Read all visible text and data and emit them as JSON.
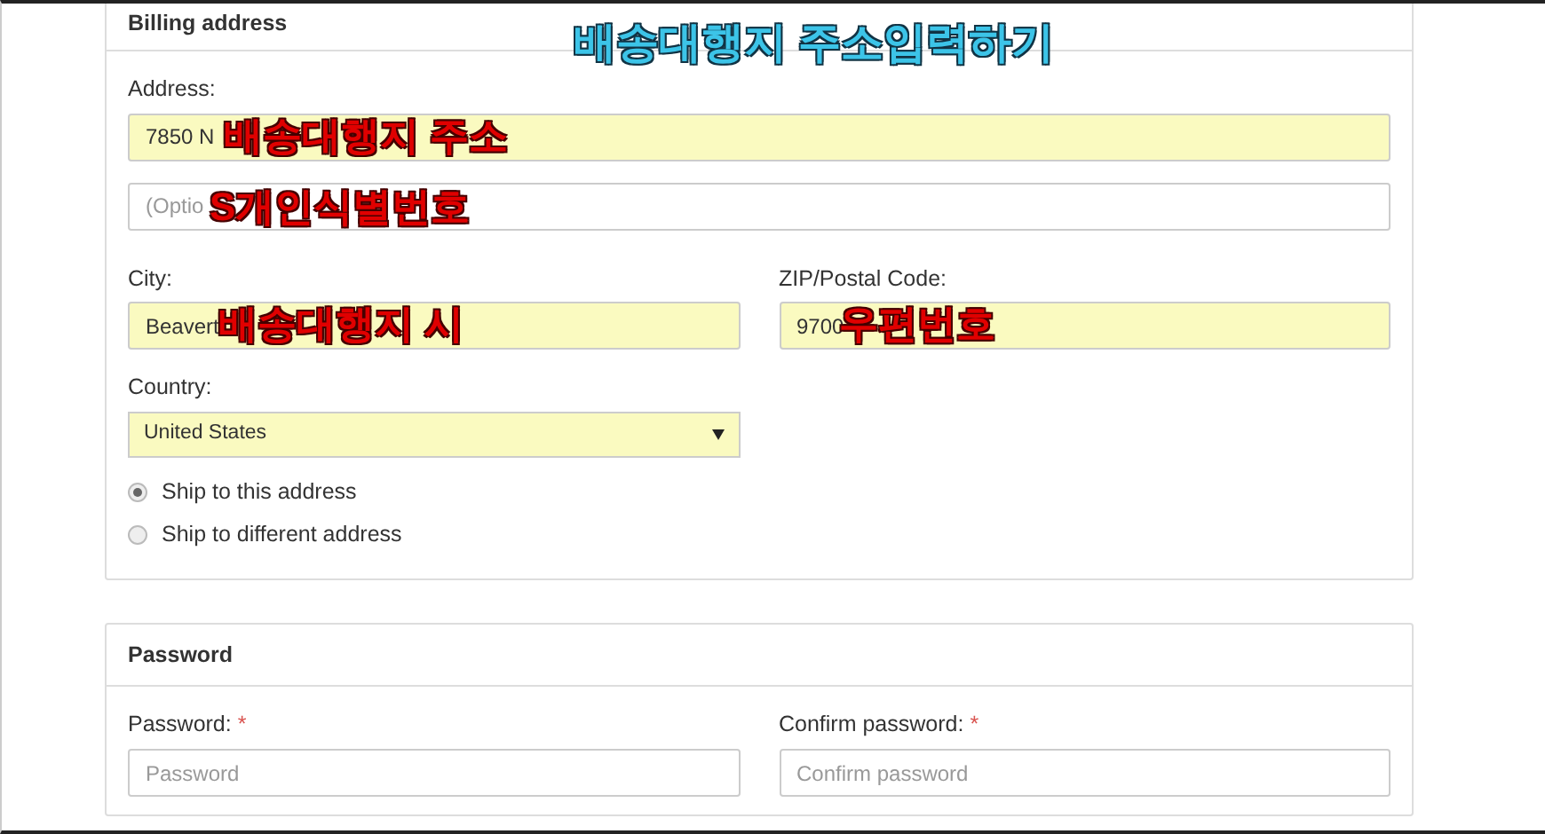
{
  "billing_address": {
    "title": "Billing address",
    "annotation": {
      "text": "배송대행지 주소입력하기",
      "kind": "title"
    },
    "address": {
      "label": "Address:",
      "value": "7850 N",
      "annotation": {
        "text": "배송대행지 주소",
        "kind": "note"
      }
    },
    "address_2": {
      "placeholder": "(Optio",
      "annotation": {
        "text": "S개인식별번호",
        "kind": "note"
      }
    },
    "city": {
      "label": "City:",
      "value": "Beavert",
      "annotation": {
        "text": "배송대행지 시",
        "kind": "note"
      }
    },
    "zip": {
      "label": "ZIP/Postal Code:",
      "value": "9700",
      "annotation": {
        "text": "우편번호",
        "kind": "note"
      }
    },
    "country": {
      "label": "Country:",
      "value": "United States"
    },
    "ship_options": [
      {
        "label": "Ship to this address",
        "selected": true
      },
      {
        "label": "Ship to different address",
        "selected": false
      }
    ]
  },
  "password_section": {
    "title": "Password",
    "fields": [
      {
        "label": "Password:",
        "required_mark": "*",
        "placeholder": "Password"
      },
      {
        "label": "Confirm password:",
        "required_mark": "*",
        "placeholder": "Confirm password"
      }
    ]
  }
}
